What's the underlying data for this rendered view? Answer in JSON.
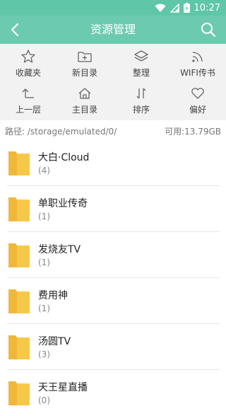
{
  "status": {
    "time": "10:27"
  },
  "header": {
    "title": "资源管理"
  },
  "toolbar": {
    "items": [
      {
        "label": "收藏夹",
        "icon": "star-icon"
      },
      {
        "label": "新目录",
        "icon": "new-folder-icon"
      },
      {
        "label": "整理",
        "icon": "layers-icon"
      },
      {
        "label": "WIFI传书",
        "icon": "wifi-icon"
      },
      {
        "label": "上一层",
        "icon": "up-level-icon"
      },
      {
        "label": "主目录",
        "icon": "home-icon"
      },
      {
        "label": "排序",
        "icon": "sort-icon"
      },
      {
        "label": "偏好",
        "icon": "heart-icon"
      }
    ]
  },
  "path": {
    "text": "路径: /storage/emulated/0/",
    "available": "可用:13.79GB"
  },
  "folders": [
    {
      "name": "大白·Cloud",
      "count": "(4)"
    },
    {
      "name": "单职业传奇",
      "count": "(1)"
    },
    {
      "name": "发烧友TV",
      "count": "(1)"
    },
    {
      "name": "费用神",
      "count": "(1)"
    },
    {
      "name": "汤圆TV",
      "count": "(3)"
    },
    {
      "name": "天王星直播",
      "count": "(0)"
    }
  ],
  "colors": {
    "accent": "#6ccab0",
    "folder": "#f6c84a"
  }
}
